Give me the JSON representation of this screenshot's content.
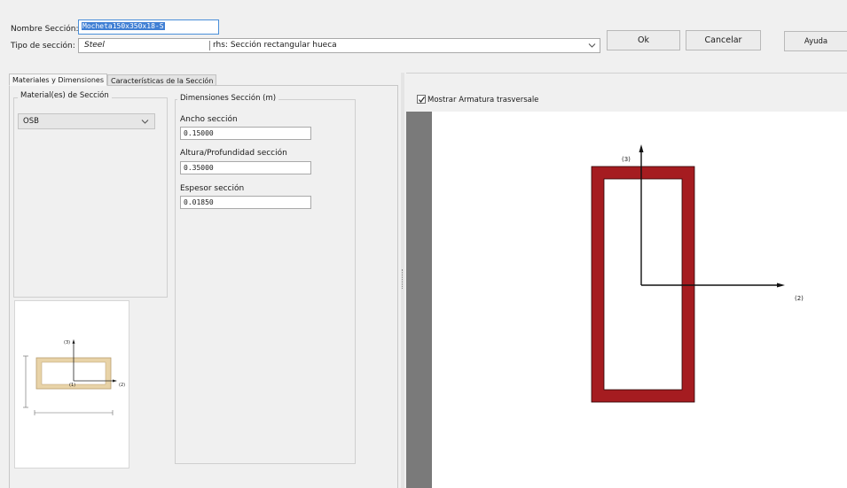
{
  "header": {
    "name_label": "Nombre Sección:",
    "name_value": "Mocheta150x350x18-S",
    "type_label": "Tipo de sección:",
    "type_value": "Steel",
    "type_desc": "rhs: Sección rectangular hueca"
  },
  "buttons": {
    "ok": "Ok",
    "cancel": "Cancelar",
    "help": "Ayuda"
  },
  "tabs": [
    "Materiales y Dimensiones",
    "Características de la Sección"
  ],
  "materials": {
    "group_title": "Material(es) de Sección",
    "selected": "OSB"
  },
  "dimensions": {
    "group_title": "Dimensiones Sección (m)",
    "width_label": "Ancho sección",
    "width_value": "0.15000",
    "height_label": "Altura/Profundidad sección",
    "height_value": "0.35000",
    "thickness_label": "Espesor sección",
    "thickness_value": "0.01850"
  },
  "preview": {
    "checkbox_label": "Mostrar Armatura trasversale",
    "checkbox_checked": true,
    "axis_vertical_label": "(3)",
    "axis_horizontal_label": "(2)",
    "section_color": "#a51c20"
  },
  "thumbnail": {
    "axis3": "(3)",
    "axis1": "(1)",
    "axis2": "(2)",
    "fill_color": "#e8d3a8"
  }
}
